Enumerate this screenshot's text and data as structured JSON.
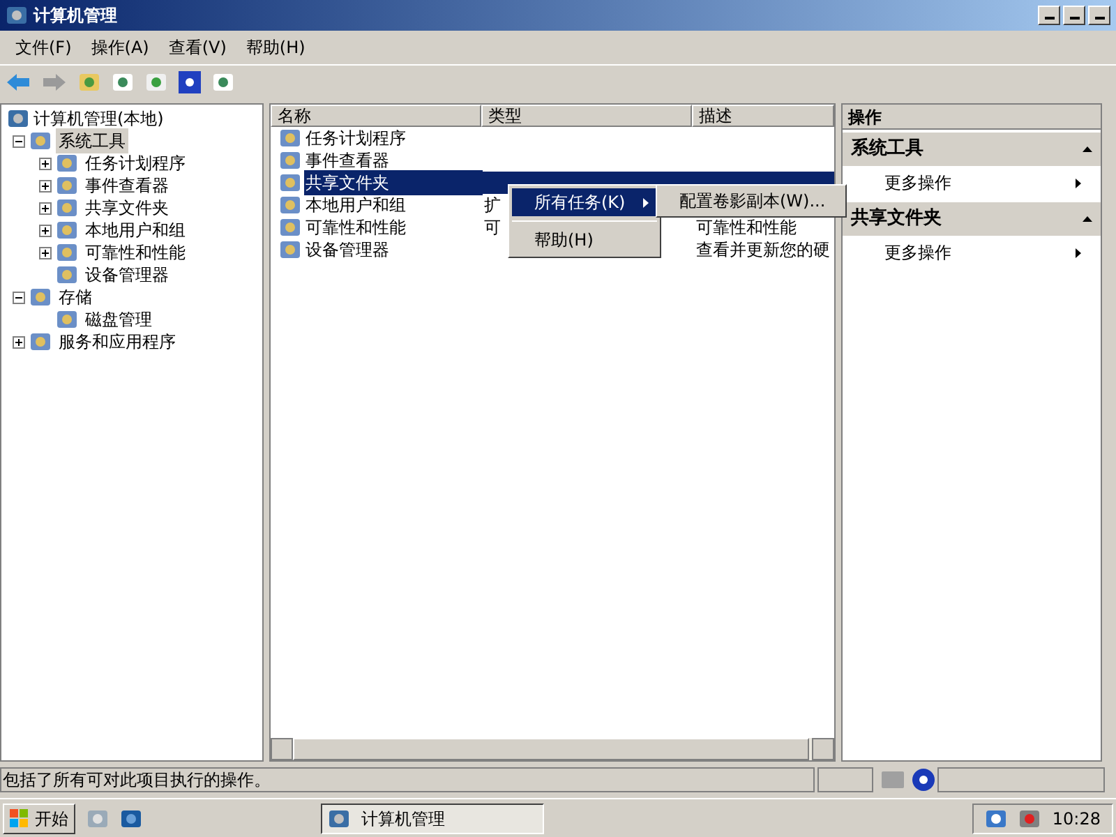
{
  "window": {
    "title": "计算机管理"
  },
  "menu": [
    "文件(F)",
    "操作(A)",
    "查看(V)",
    "帮助(H)"
  ],
  "tree": [
    {
      "label": "计算机管理(本地)",
      "selected": false,
      "children": [
        {
          "label": "系统工具",
          "selected": true,
          "expanded": true,
          "children": [
            {
              "label": "任务计划程序",
              "selected": false,
              "expanded": false
            },
            {
              "label": "事件查看器",
              "selected": false,
              "expanded": false
            },
            {
              "label": "共享文件夹",
              "selected": false,
              "expanded": false
            },
            {
              "label": "本地用户和组",
              "selected": false,
              "expanded": false
            },
            {
              "label": "可靠性和性能",
              "selected": false,
              "expanded": false
            },
            {
              "label": "设备管理器",
              "selected": false
            }
          ]
        },
        {
          "label": "存储",
          "selected": false,
          "expanded": true,
          "children": [
            {
              "label": "磁盘管理",
              "selected": false
            }
          ]
        },
        {
          "label": "服务和应用程序",
          "selected": false,
          "expanded": false
        }
      ]
    }
  ],
  "list": {
    "columns": [
      "名称",
      "类型",
      "描述"
    ],
    "rows": [
      {
        "name": "任务计划程序",
        "selected": false
      },
      {
        "name": "事件查看器",
        "selected": false
      },
      {
        "name": "共享文件夹",
        "selected": true
      },
      {
        "name": "本地用户和组",
        "type": "扩",
        "selected": false
      },
      {
        "name": "可靠性和性能",
        "type": "可",
        "description": "可靠性和性能",
        "selected": false
      },
      {
        "name": "设备管理器",
        "description": "查看并更新您的硬",
        "selected": false
      }
    ]
  },
  "context_menu": {
    "items": [
      {
        "label": "所有任务(K)",
        "selected": true,
        "submenu": true
      },
      {
        "label": "帮助(H)",
        "selected": false,
        "submenu": false
      }
    ],
    "submenu": {
      "items": [
        "配置卷影副本(W)..."
      ]
    }
  },
  "actions": {
    "title": "操作",
    "sections": [
      {
        "title": "系统工具",
        "items": [
          "更多操作"
        ]
      },
      {
        "title": "共享文件夹",
        "items": [
          "更多操作"
        ]
      }
    ]
  },
  "status_bar": {
    "text": "包括了所有可对此项目执行的操作。"
  },
  "taskbar": {
    "start": "开始",
    "tasks": [
      "计算机管理"
    ],
    "clock": "10:28"
  }
}
